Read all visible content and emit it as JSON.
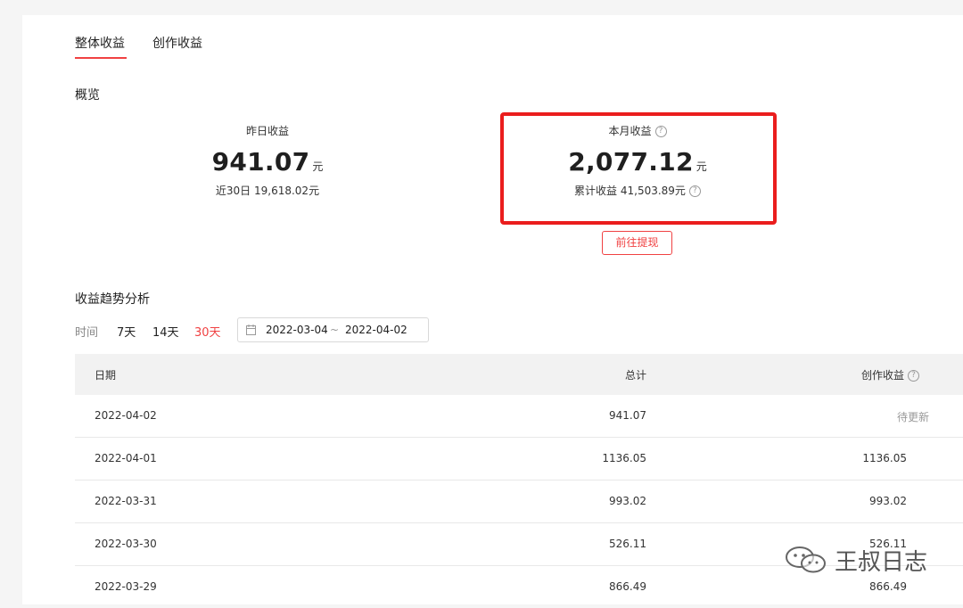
{
  "tabs": [
    {
      "label": "整体收益",
      "active": true
    },
    {
      "label": "创作收益",
      "active": false
    }
  ],
  "overview": {
    "title": "概览",
    "yesterday": {
      "label": "昨日收益",
      "value": "941.07",
      "unit": "元",
      "sub": "近30日 19,618.02元"
    },
    "month": {
      "label": "本月收益",
      "value": "2,077.12",
      "unit": "元",
      "sub": "累计收益 41,503.89元"
    },
    "withdraw_label": "前往提现"
  },
  "trend": {
    "title": "收益趋势分析",
    "time_label": "时间",
    "ranges": [
      {
        "label": "7天",
        "active": false
      },
      {
        "label": "14天",
        "active": false
      },
      {
        "label": "30天",
        "active": true
      }
    ],
    "date_start": "2022-03-04",
    "date_sep": "~",
    "date_end": "2022-04-02"
  },
  "table": {
    "headers": {
      "date": "日期",
      "total": "总计",
      "create": "创作收益"
    },
    "rows": [
      {
        "date": "2022-04-02",
        "total": "941.07",
        "create": "待更新"
      },
      {
        "date": "2022-04-01",
        "total": "1136.05",
        "create": "1136.05"
      },
      {
        "date": "2022-03-31",
        "total": "993.02",
        "create": "993.02"
      },
      {
        "date": "2022-03-30",
        "total": "526.11",
        "create": "526.11"
      },
      {
        "date": "2022-03-29",
        "total": "866.49",
        "create": "866.49"
      }
    ]
  },
  "watermark": "王叔日志",
  "colors": {
    "accent": "#f04142",
    "highlight": "#ea1d1d",
    "header_bg": "#f2f2f2"
  },
  "icons": {
    "help": "question-circle-icon",
    "calendar": "calendar-icon",
    "watermark": "wechat-icon"
  }
}
